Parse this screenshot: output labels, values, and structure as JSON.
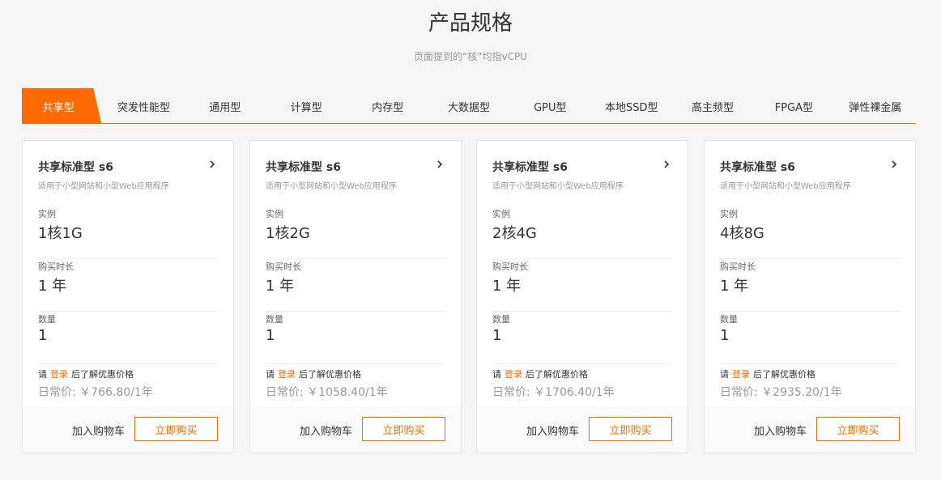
{
  "header": {
    "title": "产品规格",
    "subtitle": "页面提到的“核”均指vCPU"
  },
  "tabs": [
    {
      "label": "共享型",
      "active": true
    },
    {
      "label": "突发性能型",
      "active": false
    },
    {
      "label": "通用型",
      "active": false
    },
    {
      "label": "计算型",
      "active": false
    },
    {
      "label": "内存型",
      "active": false
    },
    {
      "label": "大数据型",
      "active": false
    },
    {
      "label": "GPU型",
      "active": false
    },
    {
      "label": "本地SSD型",
      "active": false
    },
    {
      "label": "高主频型",
      "active": false
    },
    {
      "label": "FPGA型",
      "active": false
    },
    {
      "label": "弹性裸金属",
      "active": false
    }
  ],
  "cards": [
    {
      "name": "共享标准型 s6",
      "desc": "适用于小型网站和小型Web应用程序",
      "instance_label": "实例",
      "instance_value": "1核1G",
      "duration_label": "购买时长",
      "duration_value": "1 年",
      "qty_label": "数量",
      "qty_value": "1",
      "login_prefix": "请",
      "login_link": "登录",
      "login_suffix": "后了解优惠价格",
      "price": "日常价: ￥766.80/1年",
      "cart_label": "加入购物车",
      "buy_label": "立即购买"
    },
    {
      "name": "共享标准型 s6",
      "desc": "适用于小型网站和小型Web应用程序",
      "instance_label": "实例",
      "instance_value": "1核2G",
      "duration_label": "购买时长",
      "duration_value": "1 年",
      "qty_label": "数量",
      "qty_value": "1",
      "login_prefix": "请",
      "login_link": "登录",
      "login_suffix": "后了解优惠价格",
      "price": "日常价: ￥1058.40/1年",
      "cart_label": "加入购物车",
      "buy_label": "立即购买"
    },
    {
      "name": "共享标准型 s6",
      "desc": "适用于小型网站和小型Web应用程序",
      "instance_label": "实例",
      "instance_value": "2核4G",
      "duration_label": "购买时长",
      "duration_value": "1 年",
      "qty_label": "数量",
      "qty_value": "1",
      "login_prefix": "请",
      "login_link": "登录",
      "login_suffix": "后了解优惠价格",
      "price": "日常价: ￥1706.40/1年",
      "cart_label": "加入购物车",
      "buy_label": "立即购买"
    },
    {
      "name": "共享标准型 s6",
      "desc": "适用于小型网站和小型Web应用程序",
      "instance_label": "实例",
      "instance_value": "4核8G",
      "duration_label": "购买时长",
      "duration_value": "1 年",
      "qty_label": "数量",
      "qty_value": "1",
      "login_prefix": "请",
      "login_link": "登录",
      "login_suffix": "后了解优惠价格",
      "price": "日常价: ￥2935.20/1年",
      "cart_label": "加入购物车",
      "buy_label": "立即购买"
    }
  ],
  "icons": {
    "card_arrow": "chevron-right-icon"
  },
  "colors": {
    "accent": "#ff6a00",
    "background": "#f5f5f5",
    "muted": "#999999"
  }
}
